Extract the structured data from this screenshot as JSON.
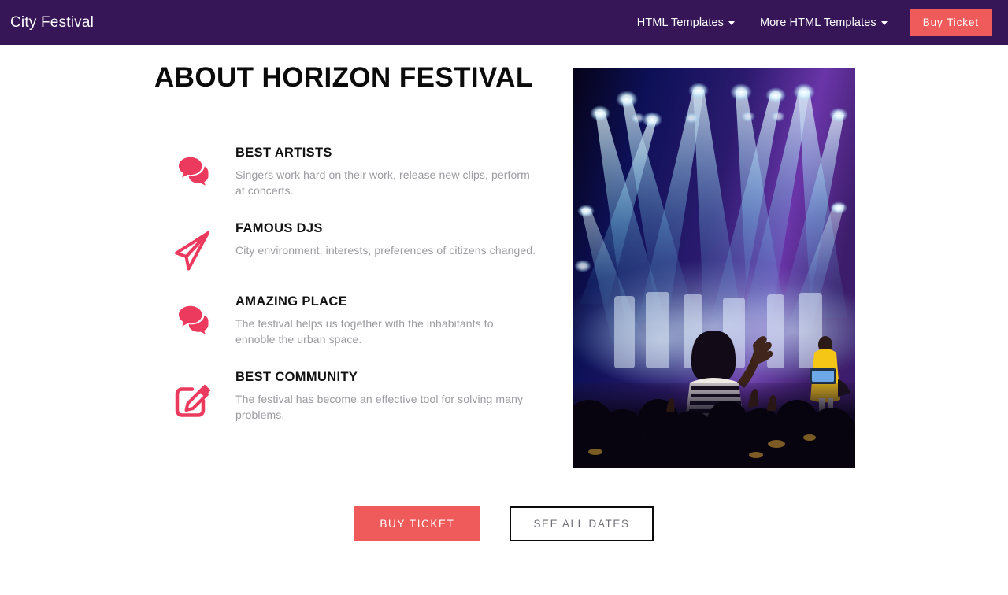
{
  "navbar": {
    "brand": "City Festival",
    "items": [
      {
        "label": "HTML Templates",
        "icon": "chevron-down-icon"
      },
      {
        "label": "More HTML Templates",
        "icon": "chevron-down-icon"
      }
    ],
    "cta": "Buy Ticket",
    "background_color": "#371657",
    "cta_color": "#ef5a5a"
  },
  "main": {
    "heading": "About Horizon Festival",
    "features": [
      {
        "icon": "comments-icon",
        "title": "Best Artists",
        "text": "Singers work hard on their work, release new clips, perform at concerts."
      },
      {
        "icon": "paper-plane-icon",
        "title": "Famous DJs",
        "text": "City environment, interests, preferences of citizens changed."
      },
      {
        "icon": "comments-icon",
        "title": "Amazing Place",
        "text": "The festival helps us together with the inhabitants to ennoble the urban space."
      },
      {
        "icon": "edit-square-icon",
        "title": "Best Community",
        "text": "The festival has become an effective tool for solving many problems."
      }
    ],
    "image": {
      "alt": "Concert crowd watching stage with blue and purple spotlights",
      "name": "festival-concert-photo"
    },
    "actions": {
      "primary": "BUY TICKET",
      "secondary": "SEE ALL DATES"
    }
  },
  "colors": {
    "accent_pink": "#ec3a5e",
    "accent_coral": "#ef5a5a",
    "header_purple": "#371657",
    "body_text": "#9b9ba0",
    "heading_text": "#0b0b0b"
  }
}
